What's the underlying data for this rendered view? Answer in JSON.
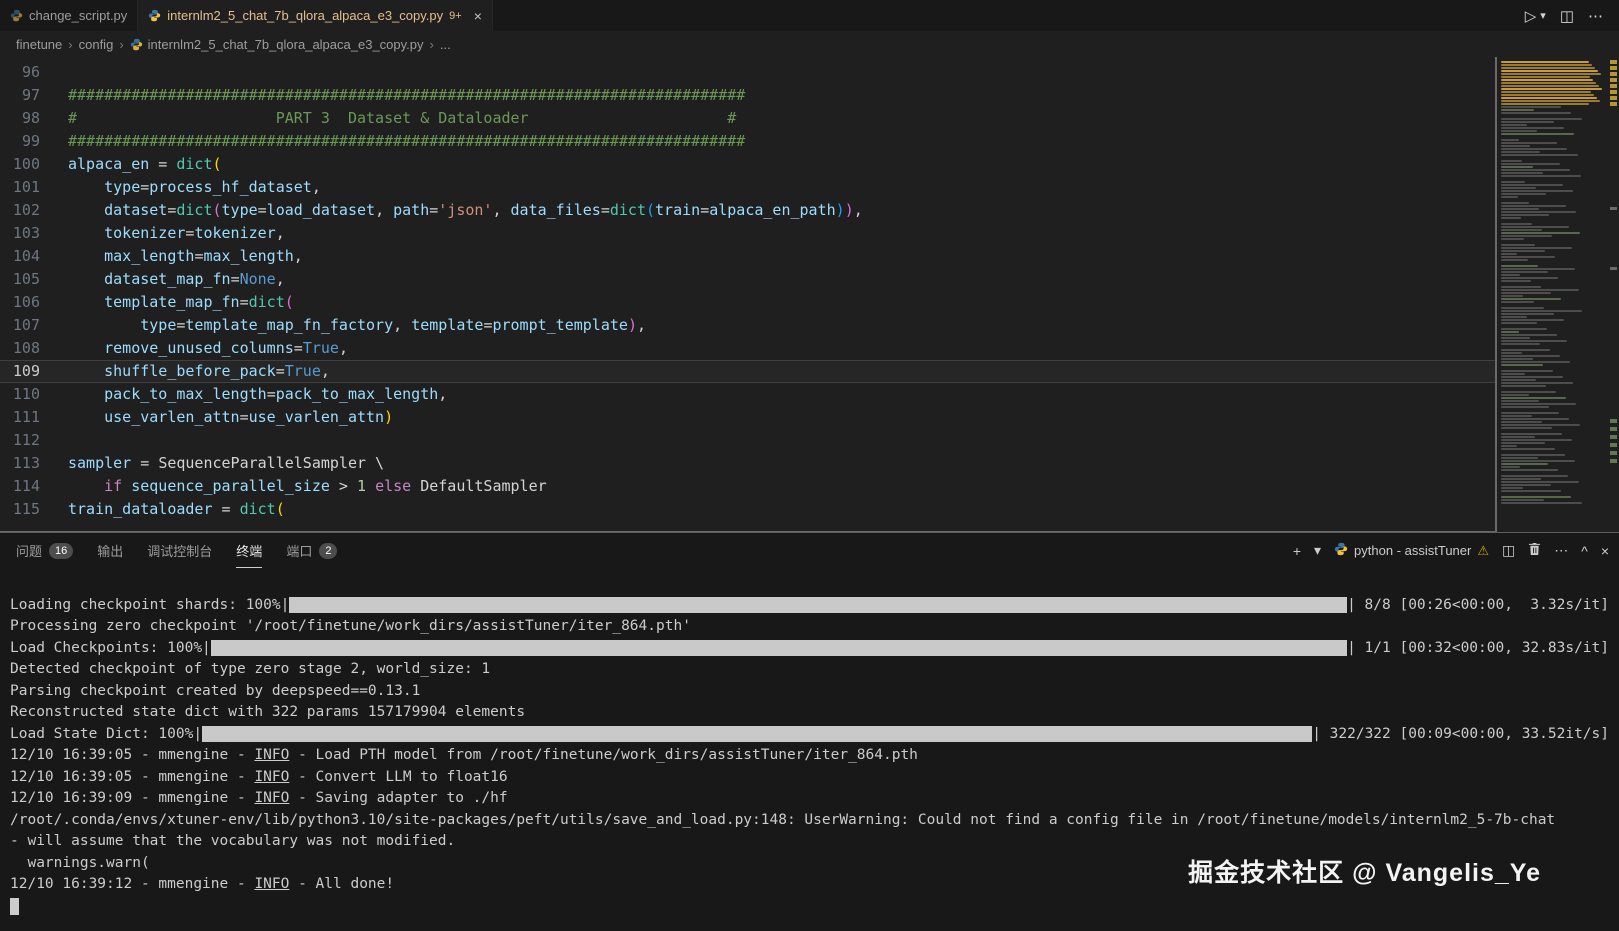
{
  "window": {
    "tabs": [
      {
        "label": "change_script.py",
        "active": false
      },
      {
        "label": "internlm2_5_chat_7b_qlora_alpaca_e3_copy.py",
        "badge": "9+",
        "active": true
      }
    ],
    "breadcrumb": {
      "items": [
        "finetune",
        "config",
        "internlm2_5_chat_7b_qlora_alpaca_e3_copy.py"
      ],
      "tail": "..."
    }
  },
  "icons": {
    "run": "▷",
    "chevron_down": "▾",
    "split_editor": "◫",
    "more": "⋯",
    "new_terminal": "+",
    "warning": "⚠",
    "maximize": "^",
    "close_panel": "×",
    "tab_close": "×",
    "breadcrumb_sep": "›"
  },
  "colors": {
    "modified_tab": "#e2c08d",
    "warning": "#cca700",
    "terminal_bar": "#c9c9c9",
    "syntax": {
      "cm": "#6A9955",
      "v": "#9CDCFE",
      "o": "#D4D4D4",
      "cl": "#4EC9B0",
      "kw": "#569CD6",
      "ct": "#C586C0",
      "s": "#CE9178",
      "n": "#B5CEA8",
      "b1": "#FFD700",
      "b2": "#DA70D6",
      "b3": "#179FFF"
    }
  },
  "editor": {
    "current_line": 109,
    "lines": [
      {
        "n": 96,
        "tokens": []
      },
      {
        "n": 97,
        "tokens": [
          [
            "cm",
            "###########################################################################"
          ]
        ]
      },
      {
        "n": 98,
        "tokens": [
          [
            "cm",
            "#                      PART 3  Dataset & Dataloader                      #"
          ]
        ]
      },
      {
        "n": 99,
        "tokens": [
          [
            "cm",
            "###########################################################################"
          ]
        ]
      },
      {
        "n": 100,
        "tokens": [
          [
            "v",
            "alpaca_en"
          ],
          [
            "o",
            " = "
          ],
          [
            "cl",
            "dict"
          ],
          [
            "b1",
            "("
          ]
        ]
      },
      {
        "n": 101,
        "tokens": [
          [
            "o",
            "    "
          ],
          [
            "v",
            "type"
          ],
          [
            "o",
            "="
          ],
          [
            "v",
            "process_hf_dataset"
          ],
          [
            "o",
            ","
          ]
        ]
      },
      {
        "n": 102,
        "tokens": [
          [
            "o",
            "    "
          ],
          [
            "v",
            "dataset"
          ],
          [
            "o",
            "="
          ],
          [
            "cl",
            "dict"
          ],
          [
            "b2",
            "("
          ],
          [
            "v",
            "type"
          ],
          [
            "o",
            "="
          ],
          [
            "v",
            "load_dataset"
          ],
          [
            "o",
            ", "
          ],
          [
            "v",
            "path"
          ],
          [
            "o",
            "="
          ],
          [
            "s",
            "'json'"
          ],
          [
            "o",
            ", "
          ],
          [
            "v",
            "data_files"
          ],
          [
            "o",
            "="
          ],
          [
            "cl",
            "dict"
          ],
          [
            "b3",
            "("
          ],
          [
            "v",
            "train"
          ],
          [
            "o",
            "="
          ],
          [
            "v",
            "alpaca_en_path"
          ],
          [
            "b3",
            ")"
          ],
          [
            "b2",
            ")"
          ],
          [
            "o",
            ","
          ]
        ]
      },
      {
        "n": 103,
        "tokens": [
          [
            "o",
            "    "
          ],
          [
            "v",
            "tokenizer"
          ],
          [
            "o",
            "="
          ],
          [
            "v",
            "tokenizer"
          ],
          [
            "o",
            ","
          ]
        ]
      },
      {
        "n": 104,
        "tokens": [
          [
            "o",
            "    "
          ],
          [
            "v",
            "max_length"
          ],
          [
            "o",
            "="
          ],
          [
            "v",
            "max_length"
          ],
          [
            "o",
            ","
          ]
        ]
      },
      {
        "n": 105,
        "tokens": [
          [
            "o",
            "    "
          ],
          [
            "v",
            "dataset_map_fn"
          ],
          [
            "o",
            "="
          ],
          [
            "kw",
            "None"
          ],
          [
            "o",
            ","
          ]
        ]
      },
      {
        "n": 106,
        "tokens": [
          [
            "o",
            "    "
          ],
          [
            "v",
            "template_map_fn"
          ],
          [
            "o",
            "="
          ],
          [
            "cl",
            "dict"
          ],
          [
            "b2",
            "("
          ]
        ]
      },
      {
        "n": 107,
        "tokens": [
          [
            "o",
            "        "
          ],
          [
            "v",
            "type"
          ],
          [
            "o",
            "="
          ],
          [
            "v",
            "template_map_fn_factory"
          ],
          [
            "o",
            ", "
          ],
          [
            "v",
            "template"
          ],
          [
            "o",
            "="
          ],
          [
            "v",
            "prompt_template"
          ],
          [
            "b2",
            ")"
          ],
          [
            "o",
            ","
          ]
        ]
      },
      {
        "n": 108,
        "tokens": [
          [
            "o",
            "    "
          ],
          [
            "v",
            "remove_unused_columns"
          ],
          [
            "o",
            "="
          ],
          [
            "kw",
            "True"
          ],
          [
            "o",
            ","
          ]
        ]
      },
      {
        "n": 109,
        "tokens": [
          [
            "o",
            "    "
          ],
          [
            "v",
            "shuffle_before_pack"
          ],
          [
            "o",
            "="
          ],
          [
            "kw",
            "True"
          ],
          [
            "o",
            ","
          ]
        ]
      },
      {
        "n": 110,
        "tokens": [
          [
            "o",
            "    "
          ],
          [
            "v",
            "pack_to_max_length"
          ],
          [
            "o",
            "="
          ],
          [
            "v",
            "pack_to_max_length"
          ],
          [
            "o",
            ","
          ]
        ]
      },
      {
        "n": 111,
        "tokens": [
          [
            "o",
            "    "
          ],
          [
            "v",
            "use_varlen_attn"
          ],
          [
            "o",
            "="
          ],
          [
            "v",
            "use_varlen_attn"
          ],
          [
            "b1",
            ")"
          ]
        ]
      },
      {
        "n": 112,
        "tokens": []
      },
      {
        "n": 113,
        "tokens": [
          [
            "v",
            "sampler"
          ],
          [
            "o",
            " = "
          ],
          [
            "o",
            "SequenceParallelSampler"
          ],
          [
            "o",
            " \\"
          ]
        ]
      },
      {
        "n": 114,
        "tokens": [
          [
            "o",
            "    "
          ],
          [
            "ct",
            "if"
          ],
          [
            "o",
            " "
          ],
          [
            "v",
            "sequence_parallel_size"
          ],
          [
            "o",
            " > "
          ],
          [
            "n",
            "1"
          ],
          [
            "o",
            " "
          ],
          [
            "ct",
            "else"
          ],
          [
            "o",
            " "
          ],
          [
            "o",
            "DefaultSampler"
          ]
        ]
      },
      {
        "n": 115,
        "tokens": [
          [
            "v",
            "train_dataloader"
          ],
          [
            "o",
            " = "
          ],
          [
            "cl",
            "dict"
          ],
          [
            "b1",
            "("
          ]
        ]
      }
    ]
  },
  "panel": {
    "tabs": [
      {
        "label": "问题",
        "badge": "16",
        "active": false
      },
      {
        "label": "输出",
        "active": false
      },
      {
        "label": "调试控制台",
        "active": false
      },
      {
        "label": "终端",
        "active": true
      },
      {
        "label": "端口",
        "badge": "2",
        "active": false
      }
    ],
    "terminal_name": "python - assistTuner"
  },
  "terminal": {
    "lines": [
      {
        "segs": [
          {
            "t": ""
          }
        ]
      },
      {
        "segs": [
          {
            "t": "Loading checkpoint shards: 100%|"
          },
          {
            "bar": true
          },
          {
            "t": "| 8/8 [00:26<00:00,  3.32s/it]"
          }
        ]
      },
      {
        "segs": [
          {
            "t": "Processing zero checkpoint '/root/finetune/work_dirs/assistTuner/iter_864.pth'"
          }
        ]
      },
      {
        "segs": [
          {
            "t": "Load Checkpoints: 100%|"
          },
          {
            "bar": true
          },
          {
            "t": "| 1/1 [00:32<00:00, 32.83s/it]"
          }
        ]
      },
      {
        "segs": [
          {
            "t": "Detected checkpoint of type zero stage 2, world_size: 1"
          }
        ]
      },
      {
        "segs": [
          {
            "t": "Parsing checkpoint created by deepspeed==0.13.1"
          }
        ]
      },
      {
        "segs": [
          {
            "t": "Reconstructed state dict with 322 params 157179904 elements"
          }
        ]
      },
      {
        "segs": [
          {
            "t": "Load State Dict: 100%|"
          },
          {
            "bar": true
          },
          {
            "t": "| 322/322 [00:09<00:00, 33.52it/s]"
          }
        ]
      },
      {
        "segs": [
          {
            "t": "12/10 16:39:05 - mmengine - "
          },
          {
            "t": "INFO",
            "u": true
          },
          {
            "t": " - Load PTH model from /root/finetune/work_dirs/assistTuner/iter_864.pth"
          }
        ]
      },
      {
        "segs": [
          {
            "t": "12/10 16:39:05 - mmengine - "
          },
          {
            "t": "INFO",
            "u": true
          },
          {
            "t": " - Convert LLM to float16"
          }
        ]
      },
      {
        "segs": [
          {
            "t": "12/10 16:39:09 - mmengine - "
          },
          {
            "t": "INFO",
            "u": true
          },
          {
            "t": " - Saving adapter to ./hf"
          }
        ]
      },
      {
        "segs": [
          {
            "t": "/root/.conda/envs/xtuner-env/lib/python3.10/site-packages/peft/utils/save_and_load.py:148: UserWarning: Could not find a config file in /root/finetune/models/internlm2_5-7b-chat"
          }
        ]
      },
      {
        "segs": [
          {
            "t": "- will assume that the vocabulary was not modified."
          }
        ]
      },
      {
        "segs": [
          {
            "t": "  warnings.warn("
          }
        ]
      },
      {
        "segs": [
          {
            "t": "12/10 16:39:12 - mmengine - "
          },
          {
            "t": "INFO",
            "u": true
          },
          {
            "t": " - All done!"
          }
        ]
      },
      {
        "segs": [
          {
            "cursor": true
          }
        ]
      }
    ]
  },
  "watermark": "掘金技术社区 @ Vangelis_Ye"
}
